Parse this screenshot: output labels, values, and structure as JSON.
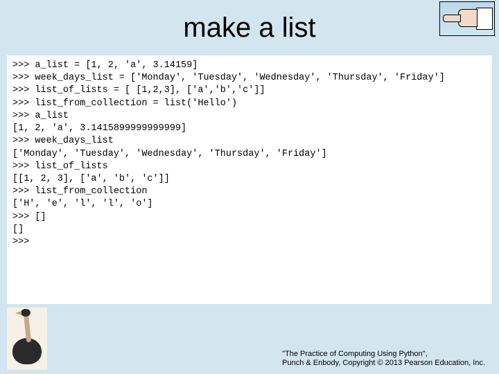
{
  "title": "make a list",
  "code_lines": [
    ">>> a_list = [1, 2, 'a', 3.14159]",
    ">>> week_days_list = ['Monday', 'Tuesday', 'Wednesday', 'Thursday', 'Friday']",
    ">>> list_of_lists = [ [1,2,3], ['a','b','c']]",
    ">>> list_from_collection = list('Hello')",
    ">>> a_list",
    "[1, 2, 'a', 3.1415899999999999]",
    ">>> week_days_list",
    "['Monday', 'Tuesday', 'Wednesday', 'Thursday', 'Friday']",
    ">>> list_of_lists",
    "[[1, 2, 3], ['a', 'b', 'c']]",
    ">>> list_from_collection",
    "['H', 'e', 'l', 'l', 'o']",
    ">>> []",
    "[]",
    ">>> "
  ],
  "footer": {
    "line1": "\"The Practice of Computing Using Python\",",
    "line2": "Punch & Enbody, Copyright © 2013 Pearson Education, Inc."
  },
  "icons": {
    "hand": "pointing-hand-icon",
    "ostrich": "ostrich-icon"
  }
}
